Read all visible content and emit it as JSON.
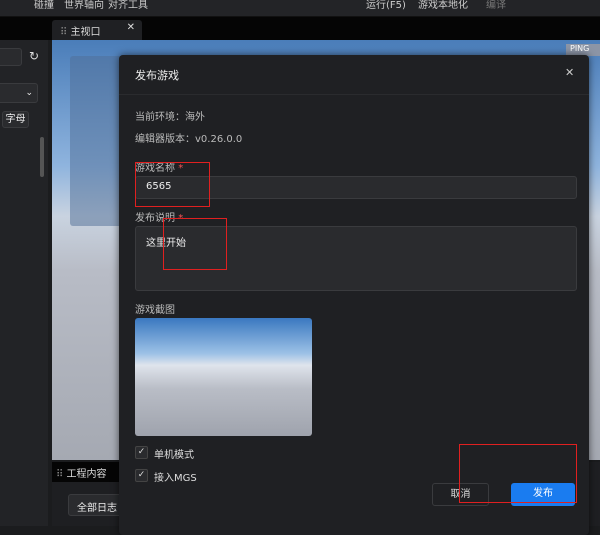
{
  "menu": [
    "碰撞",
    "世界轴向",
    "对齐工具",
    "运行(F5)",
    "游戏本地化",
    "编译"
  ],
  "viewport_tab": "主视口",
  "left_panel": {
    "sort_label": "字母"
  },
  "viewport_badge": "PING",
  "bottom_panel": {
    "tab": "工程内容",
    "filter": "全部日志"
  },
  "dialog": {
    "title": "发布游戏",
    "env": "当前环境：海外",
    "version": "编辑器版本：v0.26.0.0",
    "name_label": "游戏名称",
    "name_value": "6565",
    "desc_label": "发布说明",
    "desc_value": "这里开始",
    "shot_label": "游戏截图",
    "single_mode": "单机模式",
    "mgs": "接入MGS",
    "cancel": "取消",
    "publish": "发布",
    "required_mark": "*"
  },
  "colors": {
    "accent": "#1a7cf0",
    "annotation": "#e02020"
  }
}
